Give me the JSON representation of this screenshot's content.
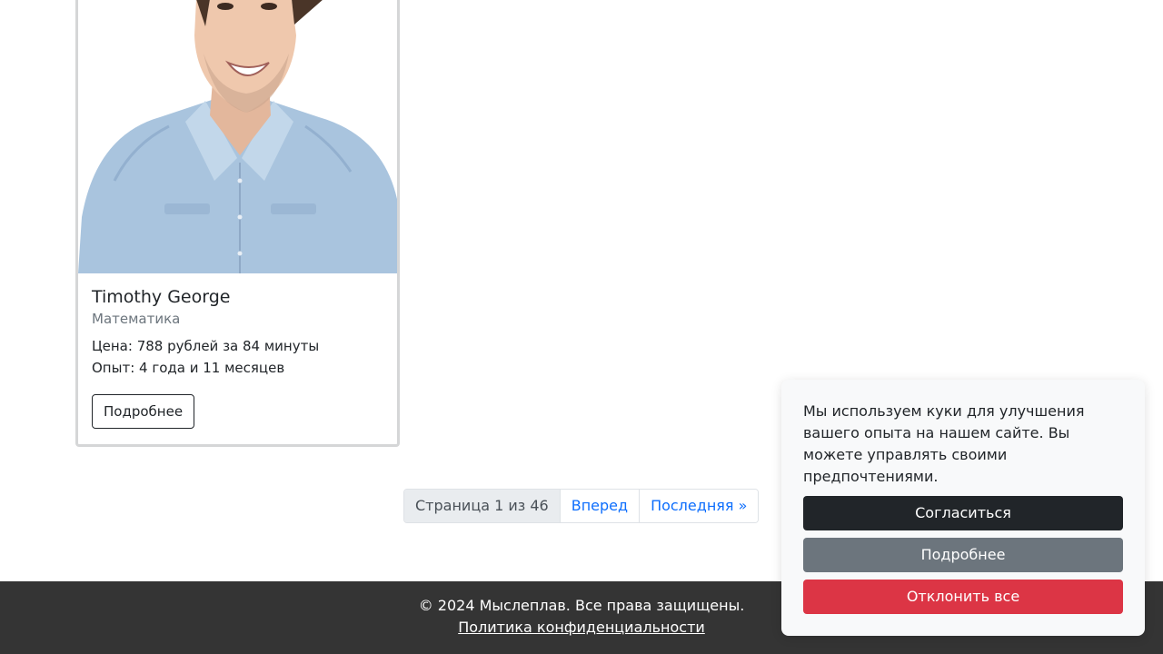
{
  "tutor_card": {
    "name": "Timothy George",
    "subject": "Математика",
    "price": "Цена: 788 рублей за 84 минуты",
    "experience": "Опыт: 4 года и 11 месяцев",
    "details_button": "Подробнее"
  },
  "pagination": {
    "current": "Страница 1 из 46",
    "next": "Вперед",
    "last": "Последняя »"
  },
  "footer": {
    "copyright": "© 2024 Мыслеплав. Все права защищены.",
    "privacy_link": "Политика конфиденциальности"
  },
  "cookie_banner": {
    "message": "Мы используем куки для улучшения вашего опыта на нашем сайте. Вы можете управлять своими предпочтениями.",
    "accept": "Согласиться",
    "more": "Подробнее",
    "reject": "Отклонить все"
  },
  "colors": {
    "accept_button": "#212529",
    "more_button": "#6c757d",
    "reject_button": "#dc3545",
    "link": "#0d6efd",
    "footer_bg": "#343434"
  }
}
